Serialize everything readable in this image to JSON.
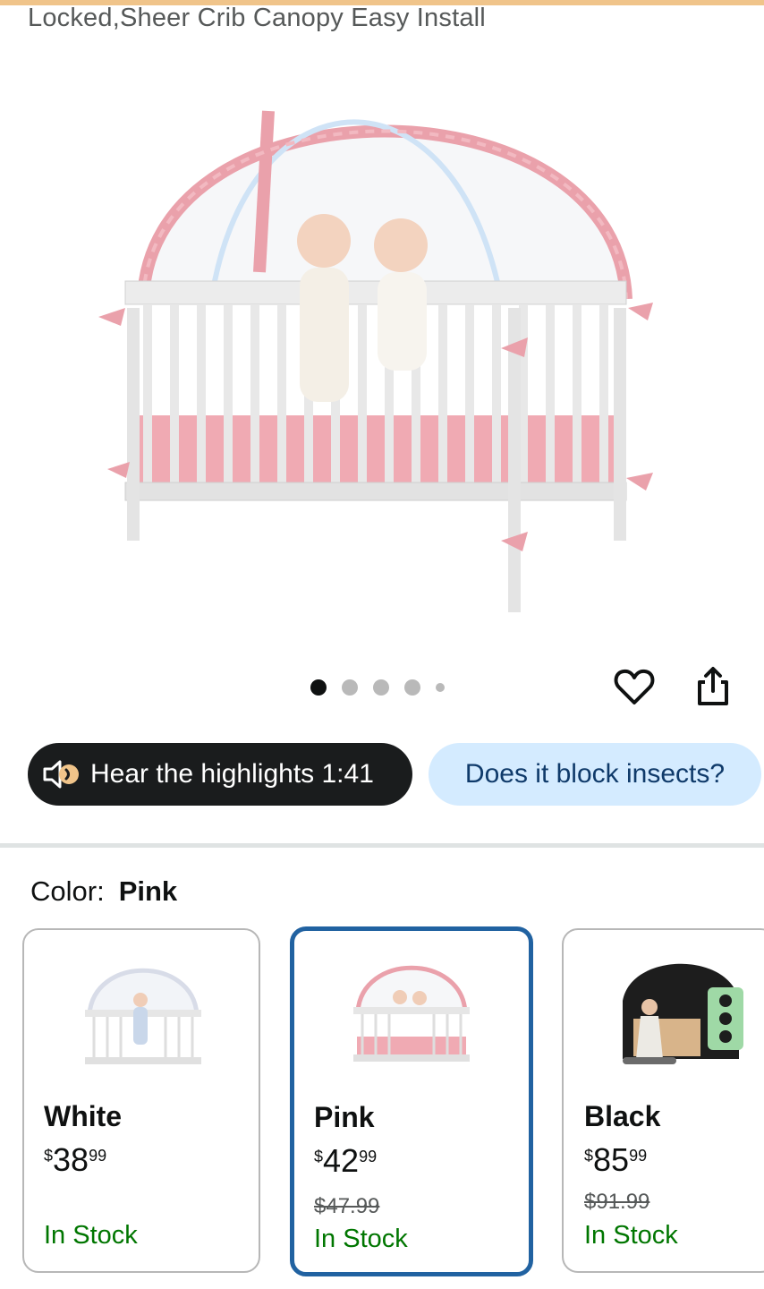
{
  "product": {
    "title_fragment": "Locked,Sheer Crib Canopy Easy Install",
    "main_image": "pink-crib-tent-with-twin-babies",
    "carousel": {
      "count": 5,
      "active_index": 0
    }
  },
  "actions": {
    "wishlist_icon": "heart-outline-icon",
    "share_icon": "share-icon"
  },
  "chips": {
    "hear_label": "Hear the highlights 1:41",
    "hear_icon": "speaker-icon",
    "ask_label": "Does it block insects?"
  },
  "variations": {
    "label": "Color:",
    "selected_value": "Pink",
    "options": [
      {
        "name": "White",
        "currency": "$",
        "whole": "38",
        "fraction": "99",
        "list_price": "",
        "stock": "In Stock",
        "selected": false
      },
      {
        "name": "Pink",
        "currency": "$",
        "whole": "42",
        "fraction": "99",
        "list_price": "$47.99",
        "stock": "In Stock",
        "selected": true
      },
      {
        "name": "Black",
        "currency": "$",
        "whole": "85",
        "fraction": "99",
        "list_price": "$91.99",
        "stock": "In Stock",
        "selected": false
      }
    ]
  },
  "colors": {
    "accent_selected": "#2162a1",
    "in_stock": "#007600",
    "chip_dark": "#1a1c1d",
    "chip_light": "#d4ebff",
    "crib_pink": "#eaa1ab"
  }
}
